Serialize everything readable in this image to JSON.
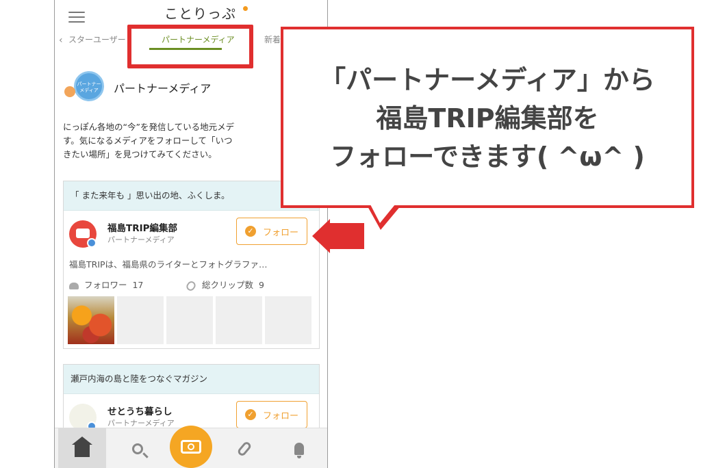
{
  "header": {
    "logo": "ことりっぷ",
    "tabs": {
      "prev": "スターユーザー",
      "active": "パートナーメディア",
      "next": "新着"
    }
  },
  "section": {
    "title": "パートナーメディア",
    "icon_label": "パートナーメディア"
  },
  "intro": "にっぽん各地の“今”を発信している地元メデ\nす。気になるメディアをフォローして「いつ\nきたい場所」を見つけてみてください。",
  "cards": [
    {
      "banner": "「 また来年も 」思い出の地、ふくしま。",
      "name": "福島TRIP編集部",
      "subtitle": "パートナーメディア",
      "follow_label": "フォロー",
      "description": "福島TRIPは、福島県のライターとフォトグラファ…",
      "followers_label": "フォロワー",
      "followers": "17",
      "clips_label": "総クリップ数",
      "clips": "9"
    },
    {
      "banner": "瀬戸内海の島と陸をつなぐマガジン",
      "name": "せとうち暮らし",
      "subtitle": "パートナーメディア",
      "follow_label": "フォロー"
    }
  ],
  "nav": [
    "home-icon",
    "search-icon",
    "camera-icon",
    "clip-icon",
    "bell-icon"
  ],
  "annotation": {
    "callout": "「パートナーメディア」から\n福島TRIP編集部を\nフォローできます( ^ω^ )"
  },
  "colors": {
    "accent_red": "#e02f2f",
    "follow_orange": "#f0a030",
    "tab_green": "#6b8e23",
    "banner_bg": "#e4f3f5"
  }
}
